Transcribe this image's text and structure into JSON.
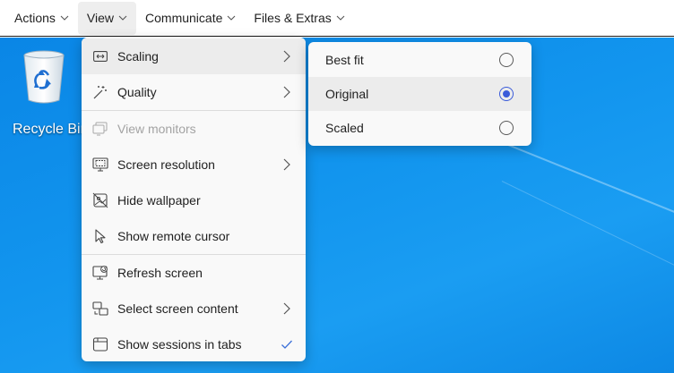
{
  "menubar": {
    "items": [
      {
        "label": "Actions"
      },
      {
        "label": "View"
      },
      {
        "label": "Communicate"
      },
      {
        "label": "Files & Extras"
      }
    ]
  },
  "desktop": {
    "icons": [
      {
        "label": "Recycle Bin",
        "icon": "recycle-bin-icon"
      }
    ]
  },
  "view_menu": {
    "items": [
      {
        "label": "Scaling",
        "icon": "scaling-icon",
        "has_submenu": true,
        "state": "highlighted"
      },
      {
        "label": "Quality",
        "icon": "quality-wand-icon",
        "has_submenu": true
      },
      {
        "label": "View monitors",
        "icon": "monitors-icon",
        "disabled": true
      },
      {
        "label": "Screen resolution",
        "icon": "screen-resolution-icon",
        "has_submenu": true
      },
      {
        "label": "Hide wallpaper",
        "icon": "hide-wallpaper-icon"
      },
      {
        "label": "Show remote cursor",
        "icon": "cursor-icon"
      },
      {
        "label": "Refresh screen",
        "icon": "refresh-screen-icon"
      },
      {
        "label": "Select screen content",
        "icon": "select-screen-icon",
        "has_submenu": true
      },
      {
        "label": "Show sessions in tabs",
        "icon": "tabs-icon",
        "checked": true
      }
    ]
  },
  "scaling_submenu": {
    "items": [
      {
        "label": "Best fit",
        "selected": false
      },
      {
        "label": "Original",
        "selected": true
      },
      {
        "label": "Scaled",
        "selected": false
      }
    ]
  },
  "colors": {
    "desktop_blue": "#1295ee",
    "menu_bg": "#f9f9f9",
    "radio_accent": "#3a5bd9",
    "check_accent": "#3a6fd8"
  }
}
